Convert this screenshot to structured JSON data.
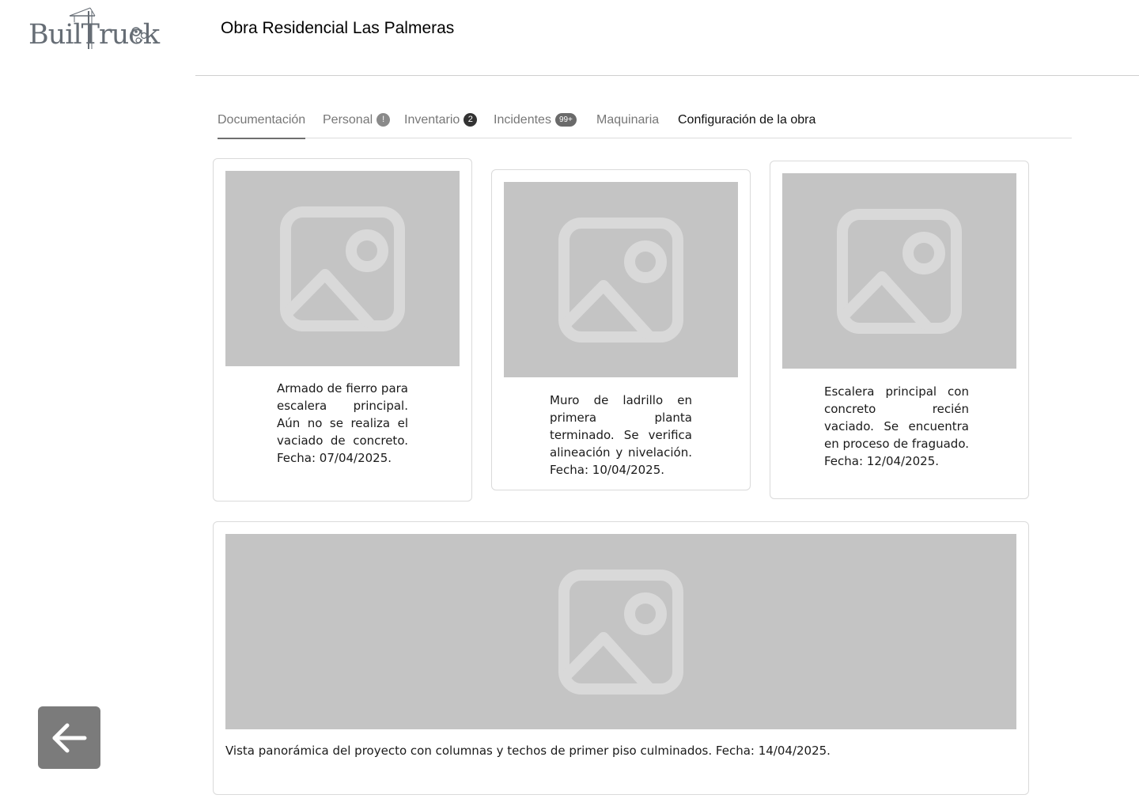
{
  "logo": {
    "text": "BuilTruck"
  },
  "header": {
    "project_title": "Obra Residencial Las Palmeras"
  },
  "tabs": [
    {
      "label": "Documentación",
      "badge": null,
      "active": true
    },
    {
      "label": "Personal",
      "badge": "!",
      "active": false
    },
    {
      "label": "Inventario",
      "badge": "2",
      "active": false
    },
    {
      "label": "Incidentes",
      "badge": "99+",
      "active": false
    },
    {
      "label": "Maquinaria",
      "badge": null,
      "active": false
    },
    {
      "label": "Configuración de la obra",
      "badge": null,
      "active": false
    }
  ],
  "gallery": [
    {
      "caption": "Armado de fierro para escalera principal. Aún no se realiza el vaciado de concreto. Fecha: 07/04/2025."
    },
    {
      "caption": "Muro de ladrillo en primera planta terminado. Se verifica alineación y nivelación. Fecha: 10/04/2025."
    },
    {
      "caption": "Escalera principal con concreto recién vaciado. Se encuentra en proceso de fraguado. Fecha: 12/04/2025."
    },
    {
      "caption": "Vista panorámica del proyecto con columnas y techos de primer piso culminados. Fecha: 14/04/2025."
    }
  ],
  "icons": {
    "image_placeholder": "image-placeholder-icon",
    "back": "arrow-left-icon",
    "logo": "crane-gears-logo"
  },
  "colors": {
    "placeholder_bg": "#c4c4c4",
    "placeholder_icon": "#d9d9d9",
    "back_button": "#7b7b7b",
    "badge": "#555555"
  }
}
